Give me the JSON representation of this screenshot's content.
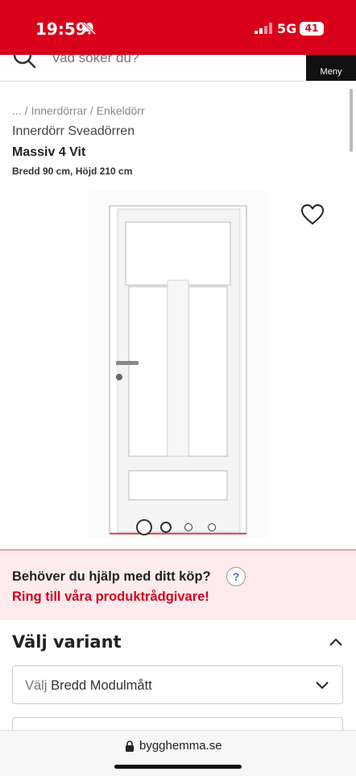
{
  "status": {
    "time": "19:59",
    "network": "5G",
    "battery": "41"
  },
  "header": {
    "search_placeholder": "Vad söker du?",
    "menu_label": "Meny"
  },
  "breadcrumb": [
    "...",
    "/",
    "Innerdörrar",
    "/",
    "Enkeldörr"
  ],
  "product": {
    "brand": "Innerdörr Sveadörren",
    "name": "Massiv 4 Vit",
    "dimensions": "Bredd 90 cm, Höjd 210 cm",
    "image_count": 4,
    "active_image": 1
  },
  "help": {
    "title": "Behöver du hjälp med ditt köp?",
    "icon_label": "?",
    "link": "Ring till våra produktrådgivare!"
  },
  "variant": {
    "heading": "Välj variant",
    "select_prefix": "Välj",
    "select_value": "Bredd Modulmått"
  },
  "browser": {
    "url": "bygghemma.se"
  },
  "colors": {
    "brand_red": "#d9001b",
    "help_bg": "#fdebee"
  }
}
